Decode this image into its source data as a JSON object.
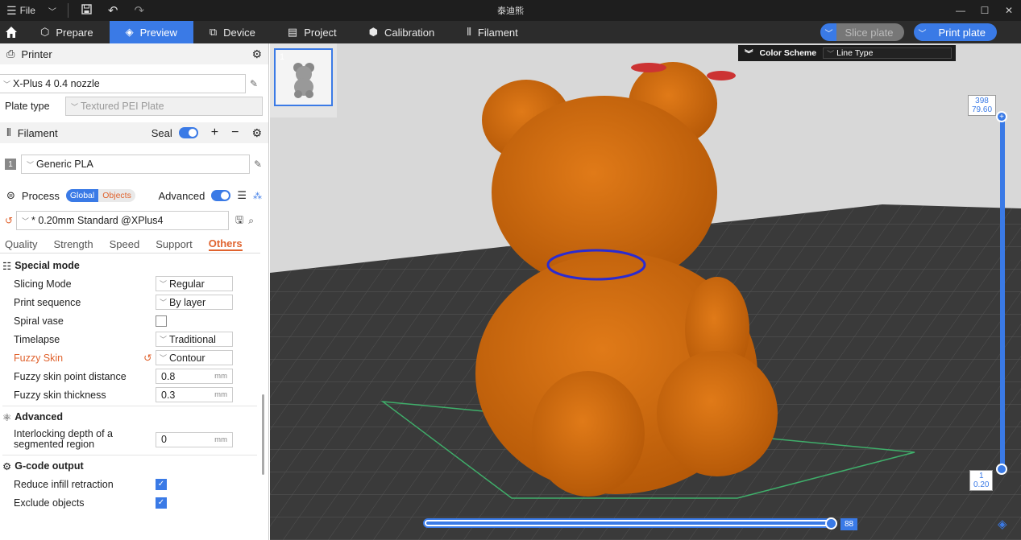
{
  "titlebar": {
    "menu": "File",
    "title": "泰迪熊"
  },
  "nav": {
    "tabs": [
      "Prepare",
      "Preview",
      "Device",
      "Project",
      "Calibration",
      "Filament"
    ],
    "slice_plate": "Slice plate",
    "print_plate": "Print plate"
  },
  "printer": {
    "header": "Printer",
    "name": "X-Plus 4 0.4 nozzle",
    "plate_type_label": "Plate type",
    "plate_type": "Textured PEI Plate"
  },
  "filament": {
    "header": "Filament",
    "seal": "Seal",
    "index": "1",
    "name": "Generic PLA"
  },
  "process": {
    "header": "Process",
    "badge_global": "Global",
    "badge_objects": "Objects",
    "advanced": "Advanced",
    "profile": "* 0.20mm Standard @XPlus4",
    "subtabs": [
      "Quality",
      "Strength",
      "Speed",
      "Support",
      "Others"
    ],
    "groups": {
      "special_mode": "Special mode",
      "advanced": "Advanced",
      "gcode_output": "G-code output"
    },
    "options": {
      "slicing_mode": {
        "label": "Slicing Mode",
        "value": "Regular"
      },
      "print_sequence": {
        "label": "Print sequence",
        "value": "By layer"
      },
      "spiral_vase": {
        "label": "Spiral vase"
      },
      "timelapse": {
        "label": "Timelapse",
        "value": "Traditional"
      },
      "fuzzy_skin": {
        "label": "Fuzzy Skin",
        "value": "Contour"
      },
      "fuzzy_point_distance": {
        "label": "Fuzzy skin point distance",
        "value": "0.8",
        "unit": "mm"
      },
      "fuzzy_thickness": {
        "label": "Fuzzy skin thickness",
        "value": "0.3",
        "unit": "mm"
      },
      "interlocking_depth": {
        "label_1": "Interlocking depth of a",
        "label_2": "segmented region",
        "value": "0",
        "unit": "mm"
      },
      "reduce_infill_retraction": {
        "label": "Reduce infill retraction",
        "checked": true
      },
      "exclude_objects": {
        "label": "Exclude objects",
        "checked": true
      }
    }
  },
  "viewport": {
    "thumb_index": "1",
    "color_scheme_label": "Color Scheme",
    "color_scheme_value": "Line Type",
    "layer_top_1": "398",
    "layer_top_2": "79.60",
    "layer_bottom_1": "1",
    "layer_bottom_2": "0.20",
    "move_slider_value": "88",
    "accent": "#3a7ae6",
    "object_color": "#d26a0e"
  }
}
